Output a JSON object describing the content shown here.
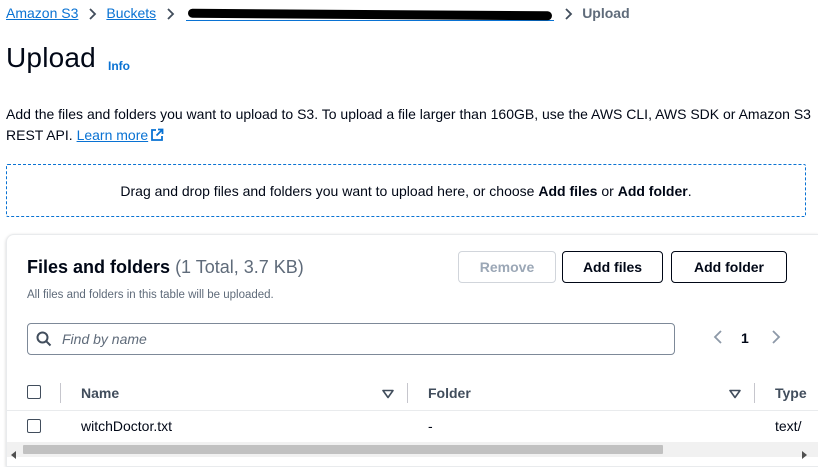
{
  "breadcrumb": {
    "items": [
      "Amazon S3",
      "Buckets"
    ],
    "redacted_item": "",
    "current": "Upload"
  },
  "header": {
    "title": "Upload",
    "info_label": "Info"
  },
  "description": {
    "text": "Add the files and folders you want to upload to S3. To upload a file larger than 160GB, use the AWS CLI, AWS SDK or Amazon S3 REST API.",
    "learn_more": "Learn more"
  },
  "dropzone": {
    "prefix": "Drag and drop files and folders you want to upload here, or choose ",
    "add_files": "Add files",
    "or": " or ",
    "add_folder": "Add folder",
    "suffix": "."
  },
  "files_panel": {
    "title": "Files and folders",
    "count": "(1 Total, 3.7 KB)",
    "subtitle": "All files and folders in this table will be uploaded.",
    "buttons": {
      "remove": "Remove",
      "add_files": "Add files",
      "add_folder": "Add folder"
    },
    "search": {
      "placeholder": "Find by name",
      "value": ""
    },
    "pagination": {
      "current_page": "1"
    },
    "table": {
      "columns": [
        "Name",
        "Folder",
        "Type"
      ],
      "rows": [
        {
          "name": "witchDoctor.txt",
          "folder": "-",
          "type": "text/"
        }
      ]
    }
  },
  "colors": {
    "link": "#0972d3",
    "text": "#000716",
    "muted": "#5f6b7a",
    "disabled": "#9ba7b6"
  }
}
